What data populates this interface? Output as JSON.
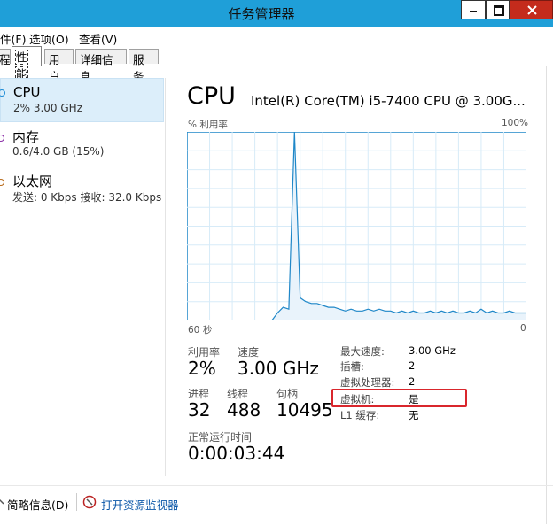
{
  "window": {
    "title": "任务管理器"
  },
  "menu": [
    "件(F)",
    "选项(O)",
    "查看(V)"
  ],
  "tabs": [
    "程",
    "性能",
    "用户",
    "详细信息",
    "服务"
  ],
  "resources": [
    {
      "name": "CPU",
      "sub": "2% 3.00 GHz",
      "color": "#1a8bd6"
    },
    {
      "name": "内存",
      "sub": "0.6/4.0 GB (15%)",
      "color": "#8b2fa8"
    },
    {
      "name": "以太网",
      "sub": "发送: 0 Kbps 接收: 32.0 Kbps",
      "color": "#b86a1a"
    }
  ],
  "cpu": {
    "heading": "CPU",
    "model": "Intel(R) Core(TM) i5-7400 CPU @ 3.00G...",
    "graph_ylabel": "% 利用率",
    "graph_ymax": "100%",
    "graph_xleft": "60 秒",
    "graph_xright": "0",
    "stats": {
      "util_label": "利用率",
      "util_value": "2%",
      "speed_label": "速度",
      "speed_value": "3.00 GHz",
      "proc_label": "进程",
      "proc_value": "32",
      "threads_label": "线程",
      "threads_value": "488",
      "handles_label": "句柄",
      "handles_value": "10495",
      "uptime_label": "正常运行时间",
      "uptime_value": "0:00:03:44"
    },
    "info": [
      {
        "k": "最大速度:",
        "v": "3.00 GHz"
      },
      {
        "k": "插槽:",
        "v": "2"
      },
      {
        "k": "虚拟处理器:",
        "v": "2"
      },
      {
        "k": "虚拟机:",
        "v": "是"
      },
      {
        "k": "L1 缓存:",
        "v": "无"
      }
    ]
  },
  "chart_data": {
    "type": "area",
    "x": [
      60,
      59,
      58,
      57,
      56,
      55,
      54,
      53,
      52,
      51,
      50,
      49,
      48,
      47,
      46,
      45,
      44,
      43,
      42,
      41,
      40,
      39,
      38,
      37,
      36,
      35,
      34,
      33,
      32,
      31,
      30,
      29,
      28,
      27,
      26,
      25,
      24,
      23,
      22,
      21,
      20,
      19,
      18,
      17,
      16,
      15,
      14,
      13,
      12,
      11,
      10,
      9,
      8,
      7,
      6,
      5,
      4,
      3,
      2,
      1,
      0
    ],
    "values": [
      0,
      0,
      0,
      0,
      0,
      0,
      0,
      0,
      0,
      0,
      0,
      0,
      0,
      0,
      0,
      0,
      4,
      7,
      6,
      100,
      12,
      10,
      9,
      9,
      8,
      7,
      7,
      6,
      5,
      6,
      5,
      5,
      6,
      5,
      6,
      5,
      5,
      4,
      5,
      4,
      5,
      4,
      4,
      5,
      4,
      5,
      4,
      5,
      4,
      4,
      5,
      4,
      6,
      4,
      5,
      4,
      4,
      5,
      4,
      4,
      4
    ],
    "ylim": [
      0,
      100
    ],
    "xlim": [
      60,
      0
    ]
  },
  "footer": {
    "summary_label": "简略信息(D)",
    "monitor_link": "打开资源监视器"
  }
}
